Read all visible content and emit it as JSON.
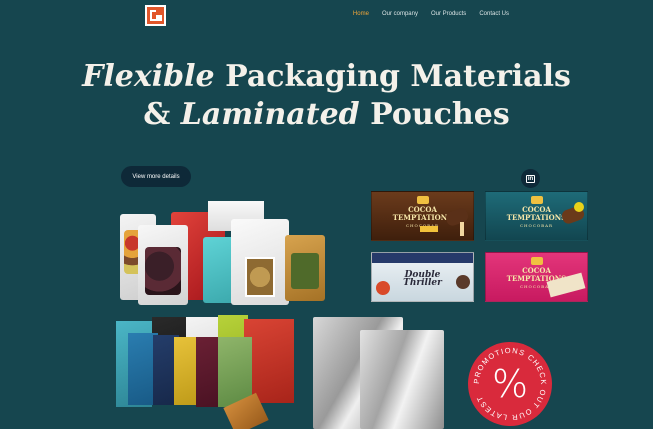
{
  "nav": {
    "home": "Home",
    "company": "Our company",
    "products": "Our Products",
    "contact": "Contact Us"
  },
  "hero": {
    "line1_italic": "Flexible",
    "line1_rest": " Packaging Materials",
    "line2_amp": "& ",
    "line2_italic": "Laminated",
    "line2_rest": " Pouches"
  },
  "cta": {
    "label": "View more details"
  },
  "social": {
    "icon": "linkedin-icon",
    "glyph": "in"
  },
  "products": {
    "choc_1": {
      "name": "COCOA TEMPTATIONS",
      "sub": "CHOCOBAR"
    },
    "choc_2": {
      "name": "COCOA TEMPTATIONS",
      "sub": "CHOCOBAR"
    },
    "choc_3": {
      "name": "Double Thriller",
      "sub": ""
    },
    "choc_4": {
      "name": "COCOA TEMPTATIONS",
      "sub": "CHOCOBAR"
    }
  },
  "promo": {
    "text": "PROMOTIONS CHECK OUT OUR LATEST",
    "symbol": "%",
    "color": "#d92a3c"
  },
  "colors": {
    "background": "#16464f",
    "accent": "#f0a63a",
    "button": "#0e2938",
    "logo": "#e2562a"
  }
}
